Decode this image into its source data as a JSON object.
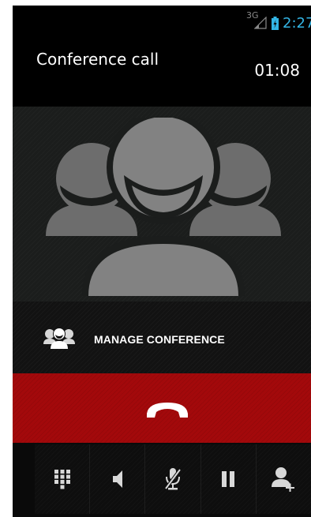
{
  "status_bar": {
    "network_type": "3G",
    "time": "2:27"
  },
  "call": {
    "title": "Conference call",
    "timer": "01:08"
  },
  "manage_conference": {
    "label": "MANAGE CONFERENCE"
  },
  "colors": {
    "end_call_red": "#a3090b",
    "status_time_blue": "#33b5e5",
    "avatar_gray": "#828282"
  },
  "icons": {
    "status": [
      "signal-icon",
      "battery-charging-icon"
    ],
    "manage": "group-icon",
    "end_call": "hang-up-phone-icon",
    "actions": [
      "dialpad-icon",
      "speaker-icon",
      "mute-mic-icon",
      "hold-icon",
      "add-call-icon"
    ]
  }
}
